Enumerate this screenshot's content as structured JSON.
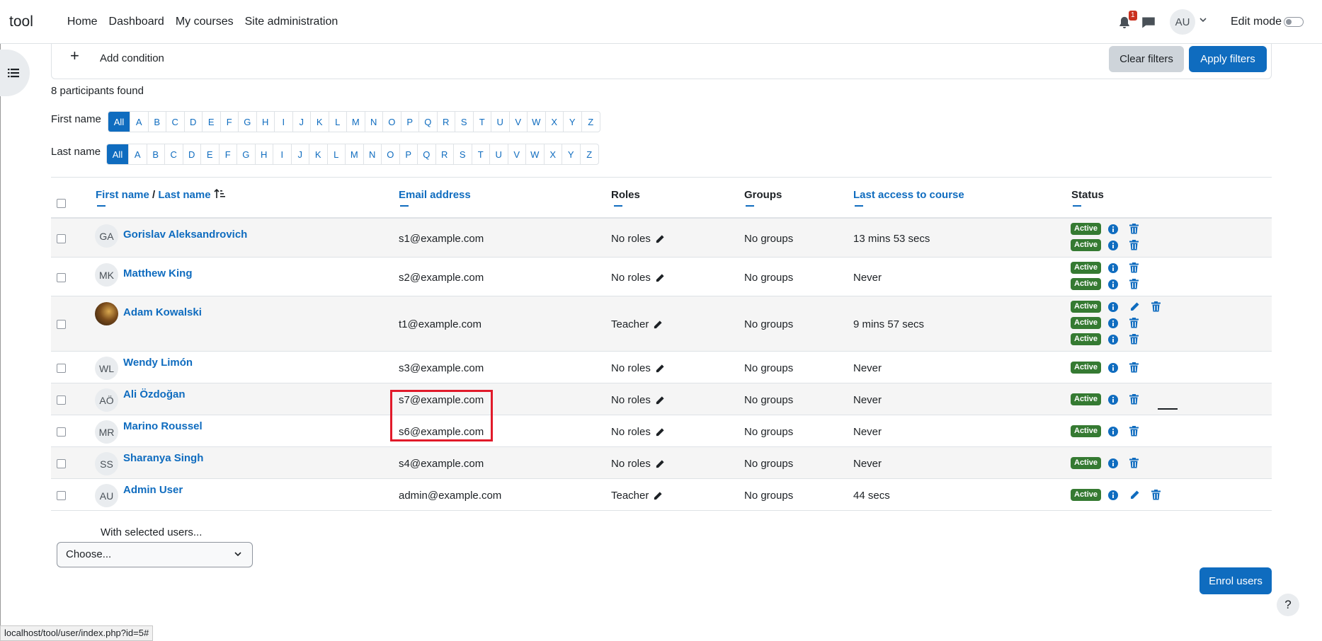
{
  "navbar": {
    "brand": "tool",
    "links": [
      "Home",
      "Dashboard",
      "My courses",
      "Site administration"
    ],
    "notification_count": "1",
    "user_initials": "AU",
    "edit_mode_label": "Edit mode"
  },
  "filters": {
    "add_condition": "Add condition",
    "clear_label": "Clear filters",
    "apply_label": "Apply filters"
  },
  "participants_found": "8 participants found",
  "initials": {
    "first_label": "First name",
    "last_label": "Last name",
    "all": "All",
    "letters": [
      "A",
      "B",
      "C",
      "D",
      "E",
      "F",
      "G",
      "H",
      "I",
      "J",
      "K",
      "L",
      "M",
      "N",
      "O",
      "P",
      "Q",
      "R",
      "S",
      "T",
      "U",
      "V",
      "W",
      "X",
      "Y",
      "Z"
    ]
  },
  "table": {
    "headers": {
      "first_name": "First name",
      "separator": "/",
      "last_name": "Last name",
      "email": "Email address",
      "roles": "Roles",
      "groups": "Groups",
      "last_access": "Last access to course",
      "status": "Status"
    },
    "rows": [
      {
        "initials": "GA",
        "name": "Gorislav Aleksandrovich",
        "email": "s1@example.com",
        "roles": "No roles",
        "groups": "No groups",
        "last_access": "13 mins 53 secs",
        "status": "Active"
      },
      {
        "initials": "MK",
        "name": "Matthew King",
        "email": "s2@example.com",
        "roles": "No roles",
        "groups": "No groups",
        "last_access": "Never",
        "status": "Active"
      },
      {
        "initials": "",
        "name": "Adam Kowalski",
        "email": "t1@example.com",
        "roles": "Teacher",
        "groups": "No groups",
        "last_access": "9 mins 57 secs",
        "status": "Active"
      },
      {
        "initials": "WL",
        "name": "Wendy Limón",
        "email": "s3@example.com",
        "roles": "No roles",
        "groups": "No groups",
        "last_access": "Never",
        "status": "Active"
      },
      {
        "initials": "AÖ",
        "name": "Ali Özdoğan",
        "email": "s7@example.com",
        "roles": "No roles",
        "groups": "No groups",
        "last_access": "Never",
        "status": "Active"
      },
      {
        "initials": "MR",
        "name": "Marino Roussel",
        "email": "s6@example.com",
        "roles": "No roles",
        "groups": "No groups",
        "last_access": "Never",
        "status": "Active"
      },
      {
        "initials": "SS",
        "name": "Sharanya Singh",
        "email": "s4@example.com",
        "roles": "No roles",
        "groups": "No groups",
        "last_access": "Never",
        "status": "Active"
      },
      {
        "initials": "AU",
        "name": "Admin User",
        "email": "admin@example.com",
        "roles": "Teacher",
        "groups": "No groups",
        "last_access": "44 secs",
        "status": "Active"
      }
    ]
  },
  "bulk": {
    "label": "With selected users...",
    "select_value": "Choose..."
  },
  "enrol_label": "Enrol users",
  "help_label": "?",
  "status_url": "localhost/tool/user/index.php?id=5#"
}
